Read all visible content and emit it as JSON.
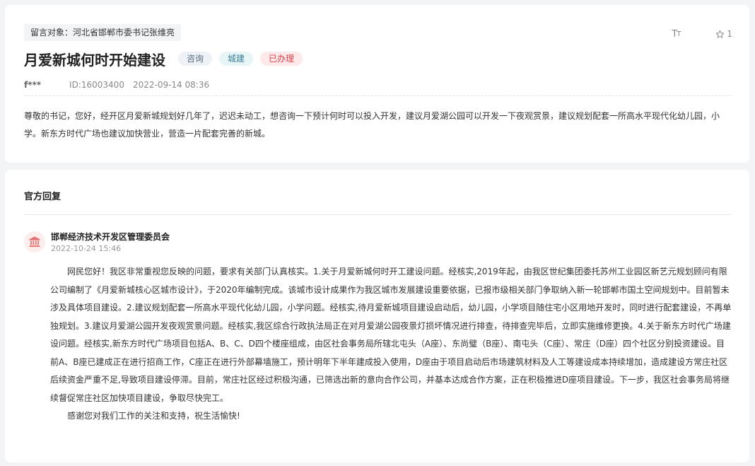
{
  "message": {
    "target": "留言对象：河北省邯郸市委书记张维亮",
    "title": "月爱新城何时开始建设",
    "tags": [
      {
        "label": "咨询",
        "color": "#5a6d86"
      },
      {
        "label": "城建",
        "color": "#3c7f95"
      },
      {
        "label": "已办理",
        "color": "#d9414b"
      }
    ],
    "author": "f***",
    "id": "ID:16003400",
    "date": "2022-09-14 08:36",
    "content": "尊敬的书记，您好，经开区月爱新城规划好几年了，迟迟未动工，想咨询一下预计何时可以投入开发，建议月爱湖公园可以开发一下夜观赏景，建议规划配套一所高水平现代化幼儿园，小学。新东方时代广场也建议加快营业，营造一片配套完善的新城。"
  },
  "toolbar": {
    "font_size_icon": "font-size-icon",
    "star_icon": "star-icon",
    "star_count": "1"
  },
  "reply": {
    "header": "官方回复",
    "org_icon": "government-building-icon",
    "org_name": "邯郸经济技术开发区管理委员会",
    "time": "2022-10-24 15:46",
    "paragraph1": "网民您好！我区非常重视您反映的问题，要求有关部门认真核实。1.关于月爱新城何时开工建设问题。经核实,2019年起，由我区世纪集团委托苏州工业园区新艺元规划顾问有限公司编制了《月爱新城核心区城市设计》，于2020年编制完成。该城市设计成果作为我区城市发展建设重要依据，已报市级相关部门争取纳入新一轮邯郸市国土空间规划中。目前暂未涉及具体项目建设。2.建议规划配套一所高水平现代化幼儿园，小学问题。经核实,待月爱新城项目建设启动后，幼儿园，小学项目随住宅小区用地开发时，同时进行配套建设，不再单独规划。3.建议月爱湖公园开发夜观赏景问题。经核实,我区综合行政执法局正在对月爱湖公园夜景灯损坏情况进行排查，待排查完毕后，立即实施维修更换。4.关于新东方时代广场建设问题。经核实,新东方时代广场项目包括A、B、C、D四个楼座组成，由区社会事务局所辖北屯头（A座）、东尚璧（B座）、南屯头（C座）、常庄（D座）四个社区分别投资建设。目前A、B座已建成正在进行招商工作，C座正在进行外部幕墙施工，预计明年下半年建成投入使用，D座由于项目启动后市场建筑材料及人工等建设成本持续增加，造成建设方常庄社区后续资金严重不足,导致项目建设停滞。目前，常庄社区经过积极沟通，已筛选出新的意向合作公司，并基本达成合作方案，正在积极推进D座项目建设。下一步，我区社会事务局将继续督促常庄社区加快项目建设，争取尽快完工。",
    "paragraph2": "感谢您对我们工作的关注和支持，祝生活愉快!"
  },
  "colors": {
    "page_bg": "#f3f4f6",
    "card_bg": "#ffffff",
    "accent_red": "#d9414b"
  }
}
